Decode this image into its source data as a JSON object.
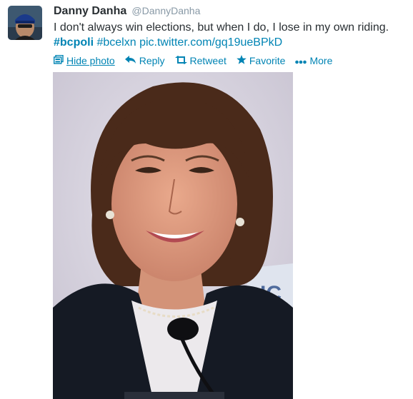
{
  "tweet": {
    "fullname": "Danny Danha",
    "username": "@DannyDanha",
    "text_main": "I don't always win elections, but when I do, I lose in my own riding.",
    "hashtag1": "#bcpoli",
    "hashtag2": "#bcelxn",
    "pic_link": "pic.twitter.com/gq19ueBPkD"
  },
  "actions": {
    "hide_photo": "Hide photo",
    "reply": "Reply",
    "retweet": "Retweet",
    "favorite": "Favorite",
    "more": "More"
  },
  "icons": {
    "photo": "photo-icon",
    "reply": "reply-arrow-icon",
    "retweet": "retweet-icon",
    "favorite": "star-icon",
    "more": "dots-icon"
  },
  "colors": {
    "link": "#0084b4",
    "username": "#8899a6",
    "text": "#292f33"
  }
}
